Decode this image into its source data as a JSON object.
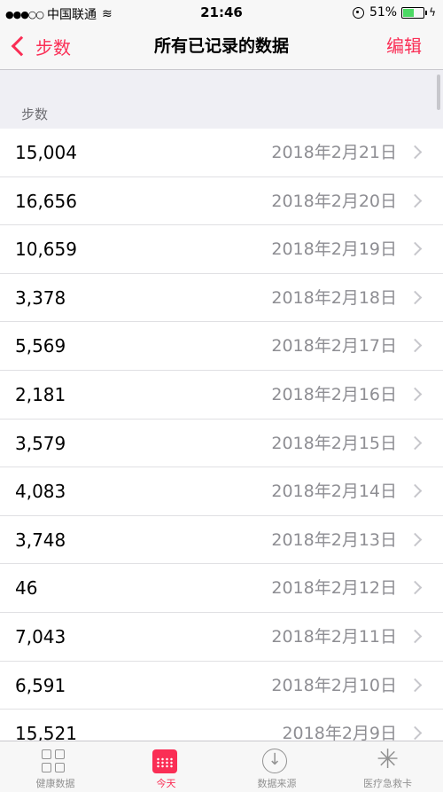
{
  "status_bar": {
    "signal": "●●●○○",
    "carrier": "中国联通",
    "time": "21:46",
    "battery": "51%",
    "battery_level": 0.51
  },
  "nav": {
    "back_label": "步数",
    "title": "所有已记录的数据",
    "edit_label": "编辑"
  },
  "section_header": "步数",
  "rows": [
    {
      "value": "15,004",
      "date": "2018年2月21日"
    },
    {
      "value": "16,656",
      "date": "2018年2月20日"
    },
    {
      "value": "10,659",
      "date": "2018年2月19日"
    },
    {
      "value": "3,378",
      "date": "2018年2月18日"
    },
    {
      "value": "5,569",
      "date": "2018年2月17日"
    },
    {
      "value": "2,181",
      "date": "2018年2月16日"
    },
    {
      "value": "3,579",
      "date": "2018年2月15日"
    },
    {
      "value": "4,083",
      "date": "2018年2月14日"
    },
    {
      "value": "3,748",
      "date": "2018年2月13日"
    },
    {
      "value": "46",
      "date": "2018年2月12日"
    },
    {
      "value": "7,043",
      "date": "2018年2月11日"
    },
    {
      "value": "6,591",
      "date": "2018年2月10日"
    },
    {
      "value": "15,521",
      "date": "2018年2月9日"
    }
  ],
  "tabs": [
    {
      "label": "健康数据",
      "icon": "grid-icon"
    },
    {
      "label": "今天",
      "icon": "calendar-icon"
    },
    {
      "label": "数据来源",
      "icon": "download-icon"
    },
    {
      "label": "医疗急救卡",
      "icon": "asterisk-icon"
    }
  ],
  "colors": {
    "accent": "#fa2e55",
    "inactive_tab": "#929292",
    "secondary_text": "#8e8e93"
  }
}
